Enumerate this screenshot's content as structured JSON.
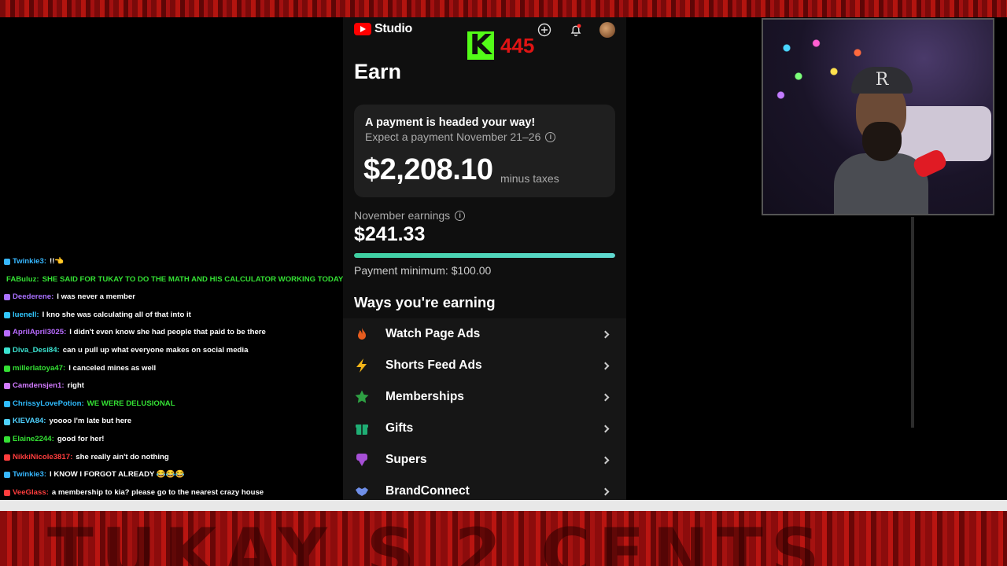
{
  "header_app": {
    "studio_label": "Studio",
    "kick_count": "445"
  },
  "earn": {
    "title": "Earn",
    "payment_card": {
      "heading": "A payment is headed your way!",
      "expect_text": "Expect a payment November 21–26",
      "amount": "$2,208.10",
      "amount_suffix": "minus taxes"
    },
    "november": {
      "label": "November earnings",
      "amount": "$241.33",
      "progress_fraction": 1.0,
      "minimum_text": "Payment minimum: $100.00"
    },
    "ways_title": "Ways you're earning",
    "ways": [
      {
        "label": "Watch Page Ads",
        "icon": "fire-icon",
        "color": "#e65c1e"
      },
      {
        "label": "Shorts Feed Ads",
        "icon": "lightning-icon",
        "color": "#f2b418"
      },
      {
        "label": "Memberships",
        "icon": "star-icon",
        "color": "#2ea043"
      },
      {
        "label": "Gifts",
        "icon": "gift-icon",
        "color": "#1fae74"
      },
      {
        "label": "Supers",
        "icon": "supers-icon",
        "color": "#a64fd6"
      },
      {
        "label": "BrandConnect",
        "icon": "handshake-icon",
        "color": "#6f8fe8"
      }
    ]
  },
  "chat": [
    {
      "user": "Twinkie3",
      "color": "#37b7ff",
      "msg": "!!👈"
    },
    {
      "user": "FABuluz",
      "color": "#34e034",
      "msg": "SHE SAID FOR TUKAY TO DO THE MATH AND HIS CALCULATOR WORKING TODAY 😂😂",
      "msg_color": "#34e034"
    },
    {
      "user": "Deederene",
      "color": "#a970ff",
      "msg": "I was never a member"
    },
    {
      "user": "luenell",
      "color": "#32c8ff",
      "msg": "I kno she was calculating all of that into it"
    },
    {
      "user": "AprilApril3025",
      "color": "#b86bff",
      "msg": "I didn't even know she had people that paid to be there"
    },
    {
      "user": "Diva_Desi84",
      "color": "#3be3d0",
      "msg": "can u pull up what everyone makes on social media"
    },
    {
      "user": "millerlatoya47",
      "color": "#34e034",
      "msg": "I canceled mines as well"
    },
    {
      "user": "Camdensjen1",
      "color": "#d27bff",
      "msg": "right"
    },
    {
      "user": "ChrissyLovePotion",
      "color": "#2fbcff",
      "msg": "WE WERE DELUSIONAL",
      "msg_color": "#34e034"
    },
    {
      "user": "KIEVA84",
      "color": "#4fd2ff",
      "msg": "yoooo I'm late but here"
    },
    {
      "user": "Elaine2244",
      "color": "#34e034",
      "msg": "good for her!"
    },
    {
      "user": "NikkiNicole3817",
      "color": "#ff3d3d",
      "msg": "she really ain't do nothing"
    },
    {
      "user": "Twinkie3",
      "color": "#37b7ff",
      "msg": "I KNOW I FORGOT ALREADY 😂😂😂"
    },
    {
      "user": "VeeGlass",
      "color": "#ff3d3d",
      "msg": "a membership to kia? please go to the nearest crazy house"
    }
  ],
  "webcam": {
    "cap_letter": "R"
  }
}
